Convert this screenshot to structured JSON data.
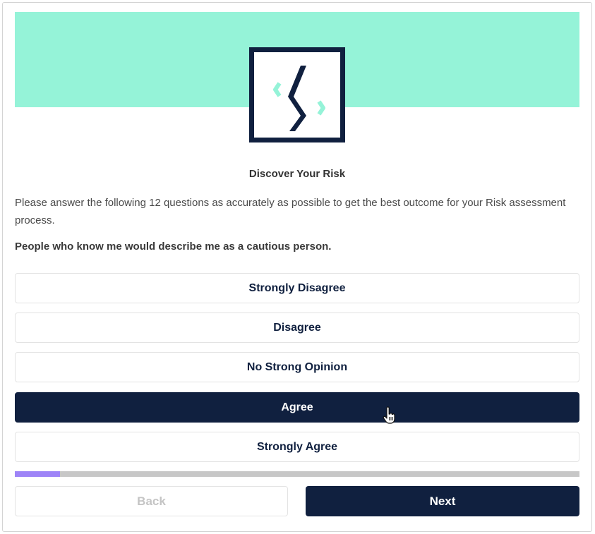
{
  "brand": {
    "accent": "#95f3d8",
    "navy": "#10203f",
    "progress": "#9e84f7"
  },
  "logo": {
    "icon": "chevron-s-logo-icon"
  },
  "title": "Discover Your Risk",
  "intro": "Please answer the following 12 questions as accurately as possible to get the best outcome for your Risk assessment process.",
  "question": "People who know me would describe me as a cautious person.",
  "options": [
    {
      "label": "Strongly Disagree",
      "selected": false
    },
    {
      "label": "Disagree",
      "selected": false
    },
    {
      "label": "No Strong Opinion",
      "selected": false
    },
    {
      "label": "Agree",
      "selected": true
    },
    {
      "label": "Strongly Agree",
      "selected": false
    }
  ],
  "progress": {
    "fraction": 0.08
  },
  "nav": {
    "back_label": "Back",
    "back_disabled": true,
    "next_label": "Next"
  }
}
